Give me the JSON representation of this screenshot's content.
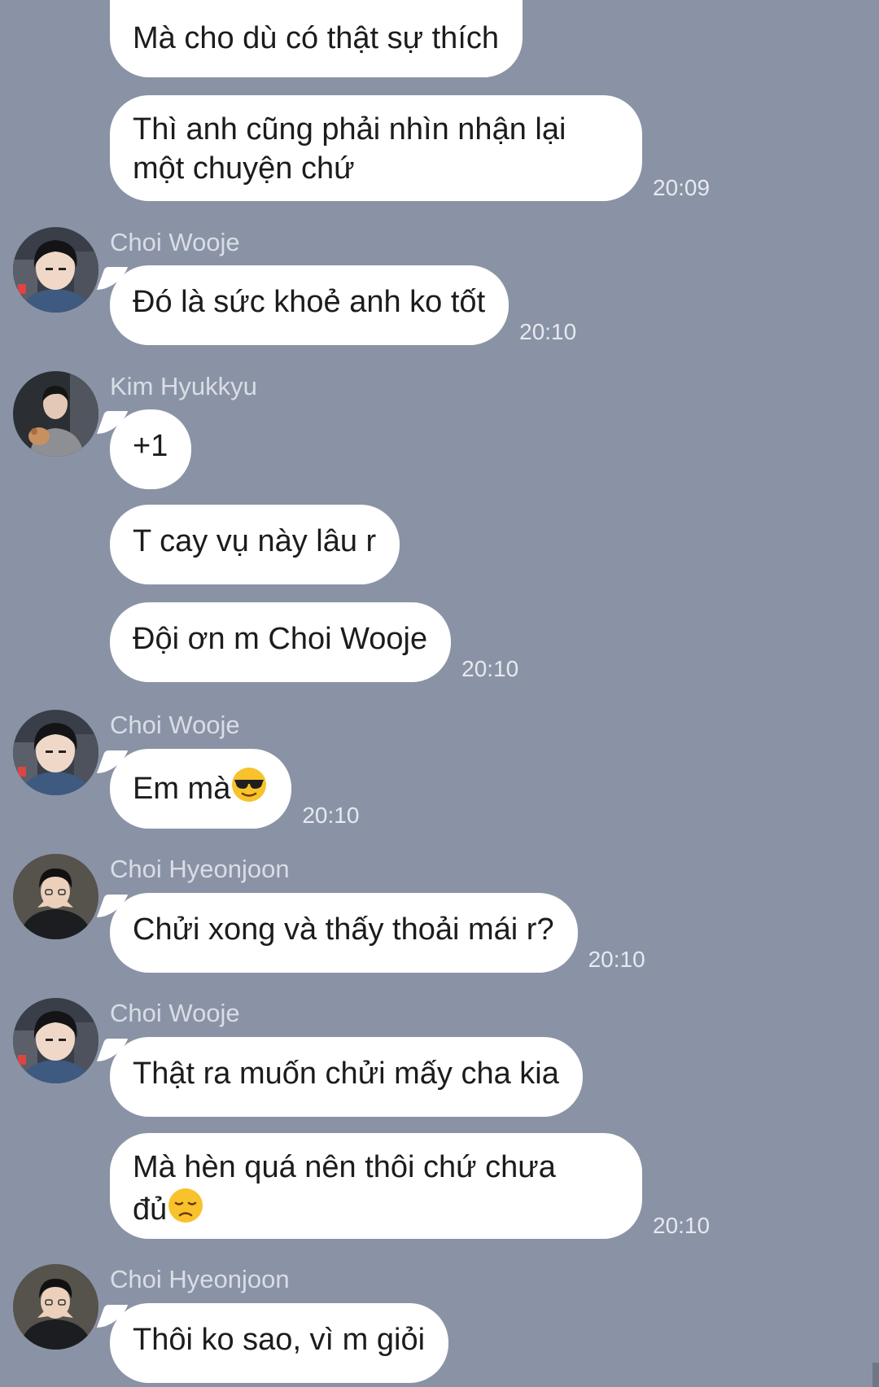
{
  "colors": {
    "background": "#8a93a5",
    "bubble": "#ffffff",
    "sender_name": "#d9dde6",
    "timestamp": "#e6e9ef"
  },
  "messages": {
    "m1": "Mà cho dù có thật sự thích",
    "m2": "Thì anh cũng phải nhìn nhận lại\nmột chuyện chứ",
    "t2": "20:09",
    "g2_sender": "Choi Wooje",
    "m3": "Đó là sức khoẻ anh ko tốt",
    "t3": "20:10",
    "g3_sender": "Kim Hyukkyu",
    "m4": "+1",
    "m5": "T cay vụ này lâu r",
    "m6": "Đội ơn m Choi Wooje",
    "t6": "20:10",
    "g4_sender": "Choi Wooje",
    "m7": "Em mà",
    "m7_emoji": "sunglasses-emoji",
    "t7": "20:10",
    "g5_sender": "Choi Hyeonjoon",
    "m8": "Chửi xong và thấy thoải mái r?",
    "t8": "20:10",
    "g6_sender": "Choi Wooje",
    "m9": "Thật ra muốn chửi mấy cha kia",
    "m10": "Mà hèn quá nên thôi chứ chưa\nđủ",
    "m10_emoji": "disappointed-emoji",
    "t10": "20:10",
    "g7_sender": "Choi Hyeonjoon",
    "m11": "Thôi ko sao, vì m giỏi"
  }
}
